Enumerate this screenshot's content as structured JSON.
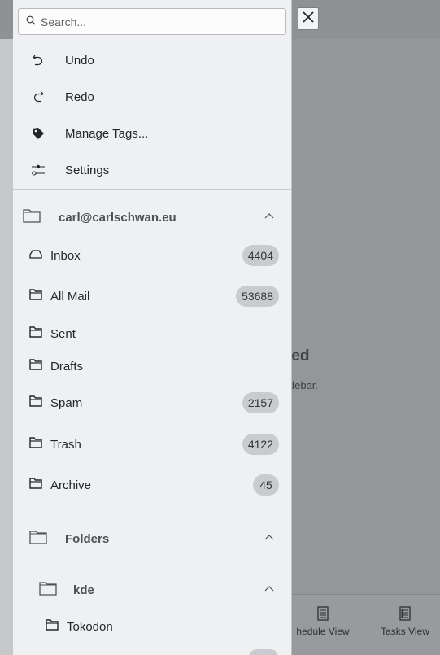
{
  "background": {
    "title_fragment": "ted",
    "subtitle_fragment": "idebar.",
    "tabs": [
      {
        "label": "hedule View",
        "icon": "calendar-list-icon"
      },
      {
        "label": "Tasks View",
        "icon": "tasks-list-icon"
      }
    ]
  },
  "search": {
    "placeholder": "Search..."
  },
  "menu": [
    {
      "label": "Undo",
      "icon": "undo-icon"
    },
    {
      "label": "Redo",
      "icon": "redo-icon"
    },
    {
      "label": "Manage Tags...",
      "icon": "tag-icon"
    },
    {
      "label": "Settings",
      "icon": "settings-sliders-icon"
    }
  ],
  "account": {
    "name": "carl@carlschwan.eu",
    "folders": [
      {
        "label": "Inbox",
        "count": "4404",
        "icon": "inbox-icon"
      },
      {
        "label": "All Mail",
        "count": "53688",
        "icon": "folder-icon"
      },
      {
        "label": "Sent",
        "count": "",
        "icon": "folder-icon"
      },
      {
        "label": "Drafts",
        "count": "",
        "icon": "folder-icon"
      },
      {
        "label": "Spam",
        "count": "2157",
        "icon": "folder-icon"
      },
      {
        "label": "Trash",
        "count": "4122",
        "icon": "folder-icon"
      },
      {
        "label": "Archive",
        "count": "45",
        "icon": "folder-icon"
      }
    ]
  },
  "folders_section": {
    "label": "Folders"
  },
  "kde_section": {
    "label": "kde",
    "items": [
      {
        "label": "Tokodon"
      }
    ]
  }
}
